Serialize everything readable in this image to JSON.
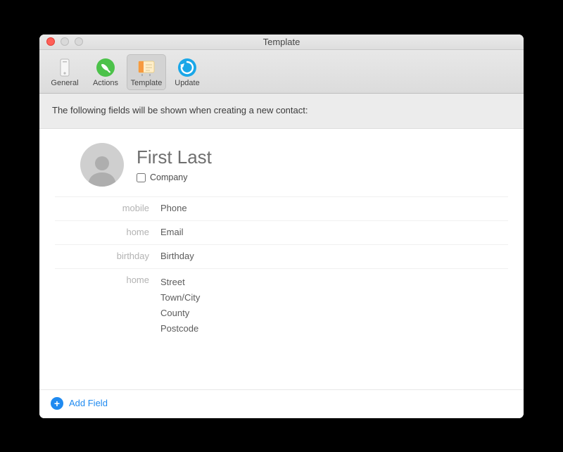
{
  "window": {
    "title": "Template"
  },
  "toolbar": {
    "items": [
      {
        "label": "General",
        "selected": false
      },
      {
        "label": "Actions",
        "selected": false
      },
      {
        "label": "Template",
        "selected": true
      },
      {
        "label": "Update",
        "selected": false
      }
    ]
  },
  "info_text": "The following fields will be shown when creating a new contact:",
  "card": {
    "name_placeholder": "First Last",
    "company_label": "Company",
    "company_checked": false,
    "fields": [
      {
        "label": "mobile",
        "value": "Phone"
      },
      {
        "label": "home",
        "value": "Email"
      },
      {
        "label": "birthday",
        "value": "Birthday"
      }
    ],
    "address": {
      "label": "home",
      "lines": [
        "Street",
        "Town/City",
        "County",
        "Postcode"
      ]
    }
  },
  "footer": {
    "add_field_label": "Add Field"
  },
  "colors": {
    "accent": "#1f8af0"
  }
}
